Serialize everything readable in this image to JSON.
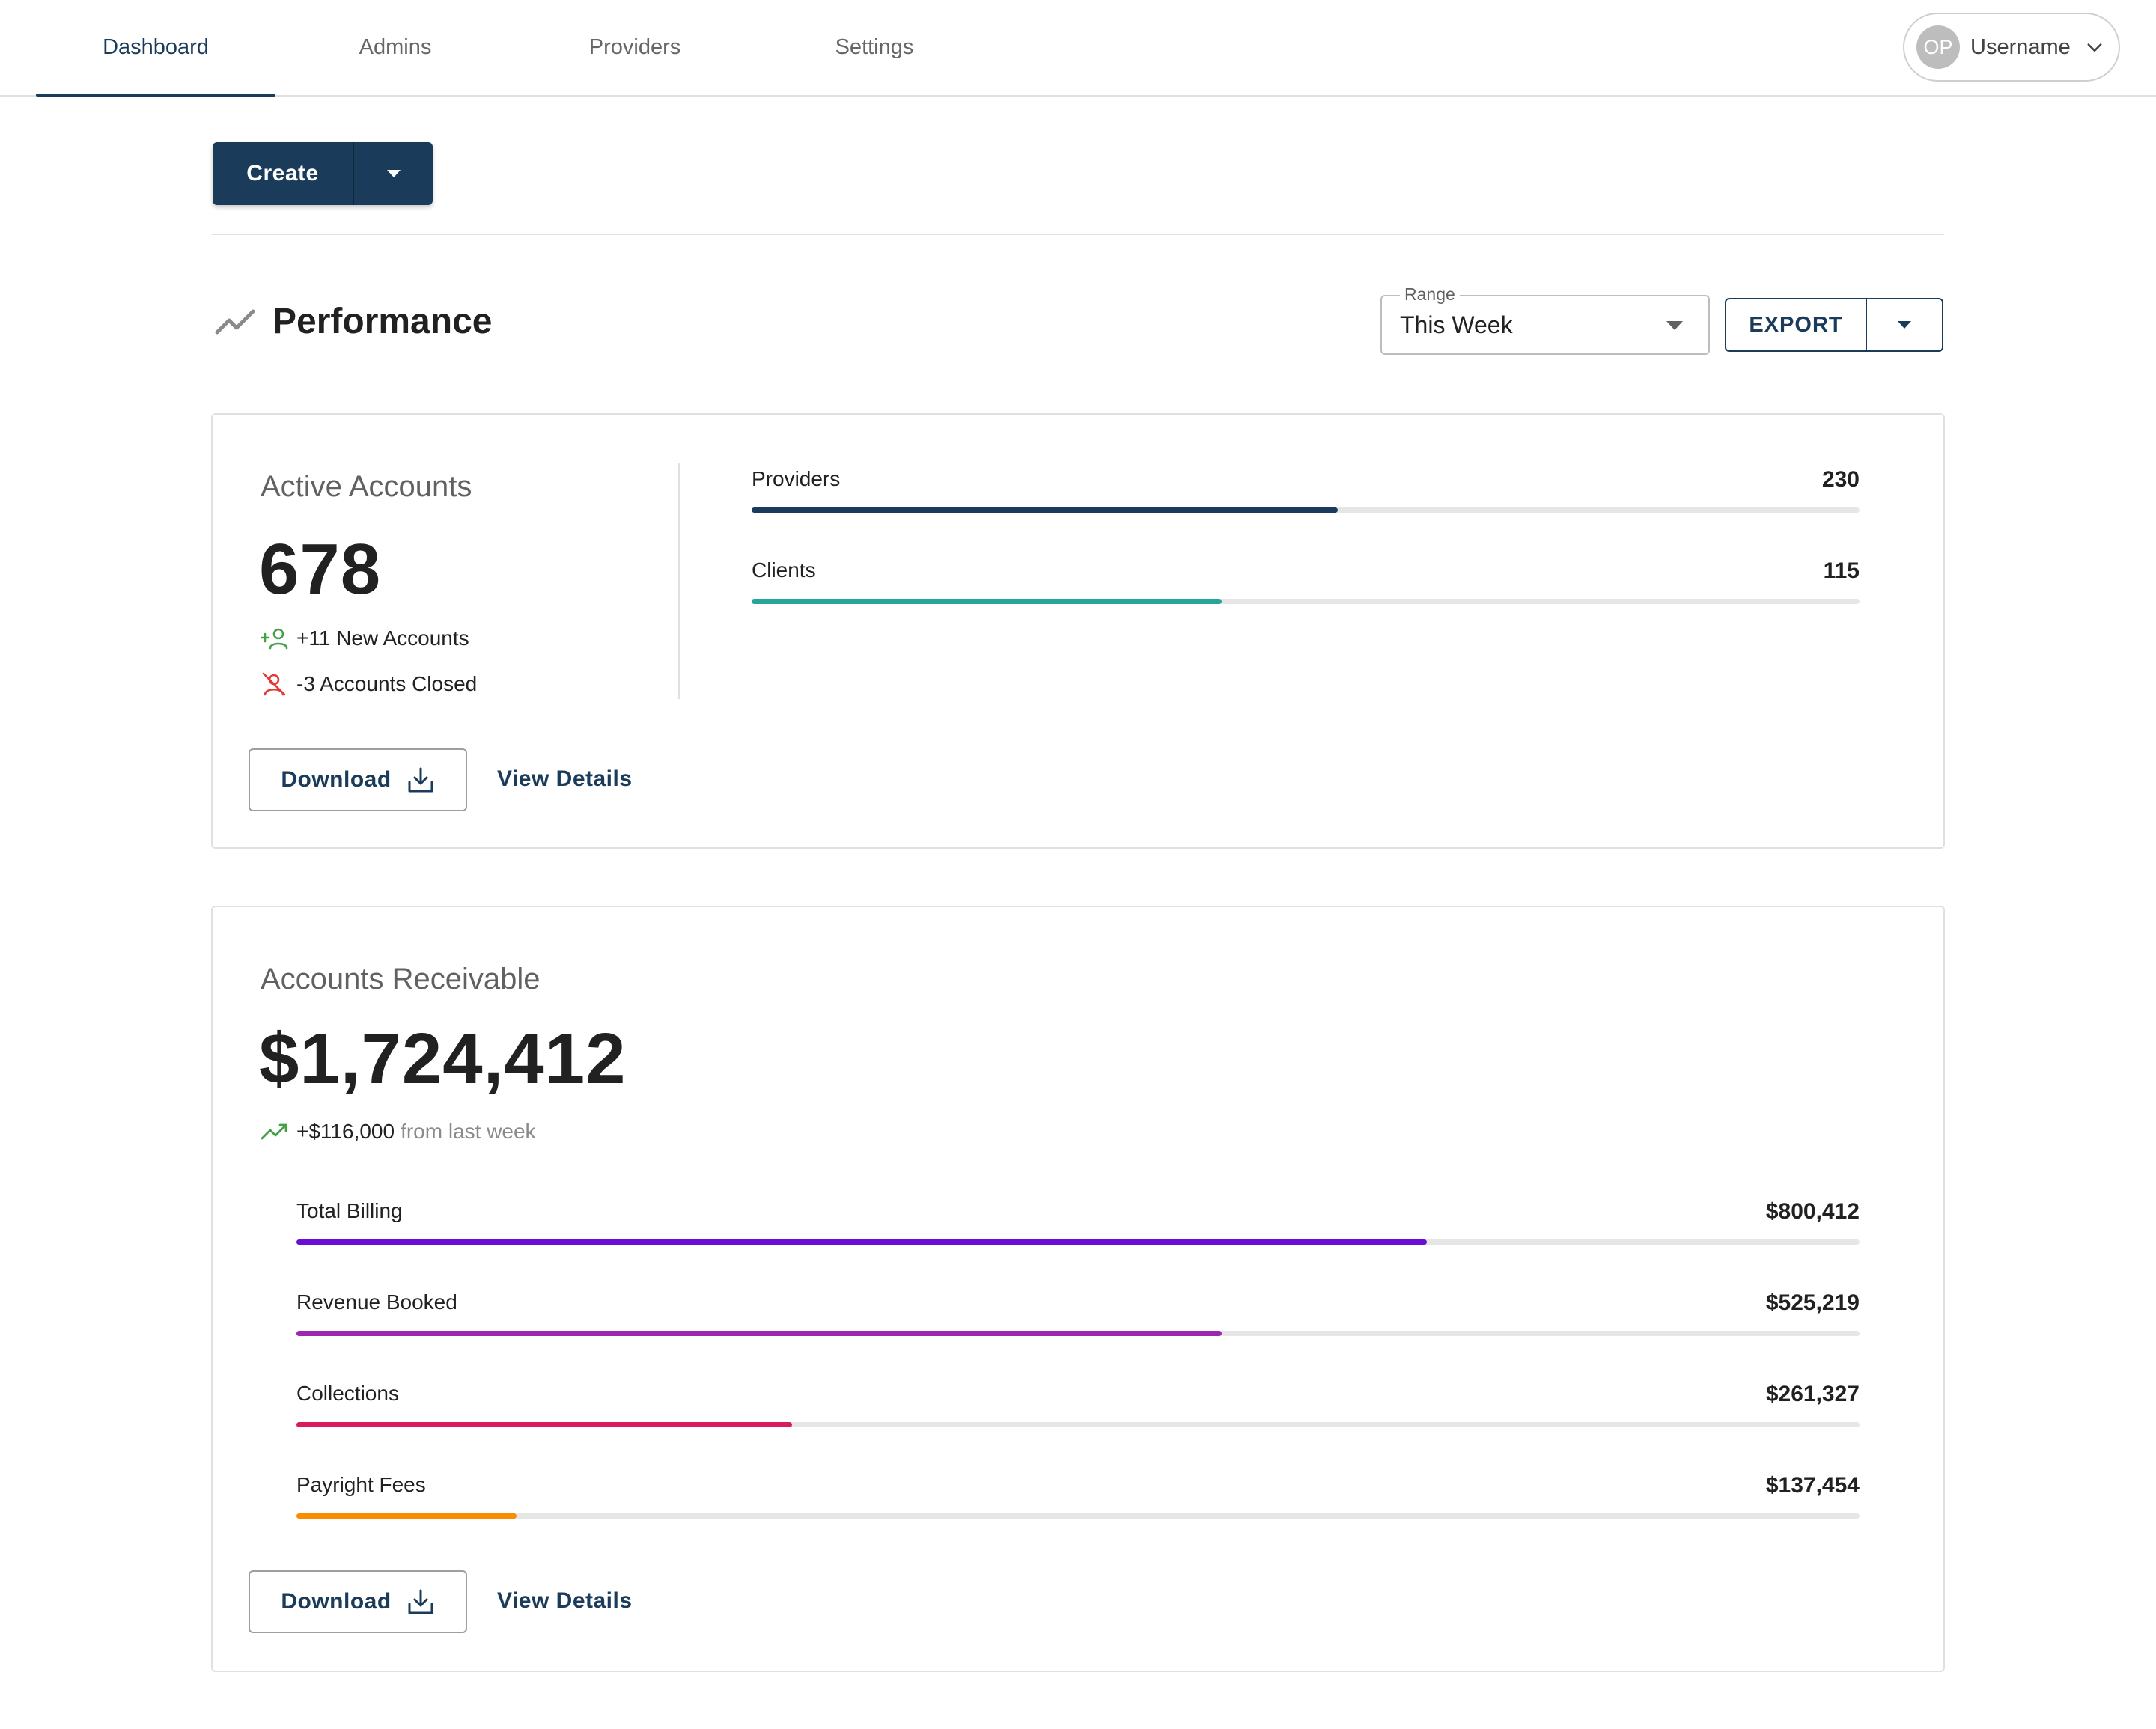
{
  "nav": {
    "tabs": [
      {
        "label": "Dashboard",
        "active": true
      },
      {
        "label": "Admins",
        "active": false
      },
      {
        "label": "Providers",
        "active": false
      },
      {
        "label": "Settings",
        "active": false
      }
    ],
    "user": {
      "initials": "OP",
      "name": "Username"
    }
  },
  "toolbar": {
    "create_label": "Create"
  },
  "performance": {
    "title": "Performance",
    "range_label": "Range",
    "range_value": "This Week",
    "export_label": "EXPORT"
  },
  "active_accounts": {
    "title": "Active Accounts",
    "value": "678",
    "new_accounts": "+11 New Accounts",
    "closed_accounts": "-3 Accounts Closed",
    "bars": [
      {
        "label": "Providers",
        "value": "230",
        "fraction": 0.529,
        "color": "#1b3b5a"
      },
      {
        "label": "Clients",
        "value": "115",
        "fraction": 0.424,
        "color": "#26a69a"
      }
    ],
    "download_label": "Download",
    "view_details_label": "View Details"
  },
  "accounts_receivable": {
    "title": "Accounts Receivable",
    "value": "$1,724,412",
    "change": "+$116,000",
    "change_suffix": "from last week",
    "bars": [
      {
        "label": "Total Billing",
        "value": "$800,412",
        "fraction": 0.723,
        "color": "#6a0dd6"
      },
      {
        "label": "Revenue Booked",
        "value": "$525,219",
        "fraction": 0.592,
        "color": "#9c27b0"
      },
      {
        "label": "Collections",
        "value": "$261,327",
        "fraction": 0.317,
        "color": "#d81b60"
      },
      {
        "label": "Payright Fees",
        "value": "$137,454",
        "fraction": 0.141,
        "color": "#fb8c00"
      }
    ],
    "download_label": "Download",
    "view_details_label": "View Details"
  },
  "colors": {
    "primary": "#1b3b5a",
    "success": "#43a047",
    "danger": "#e53935"
  }
}
